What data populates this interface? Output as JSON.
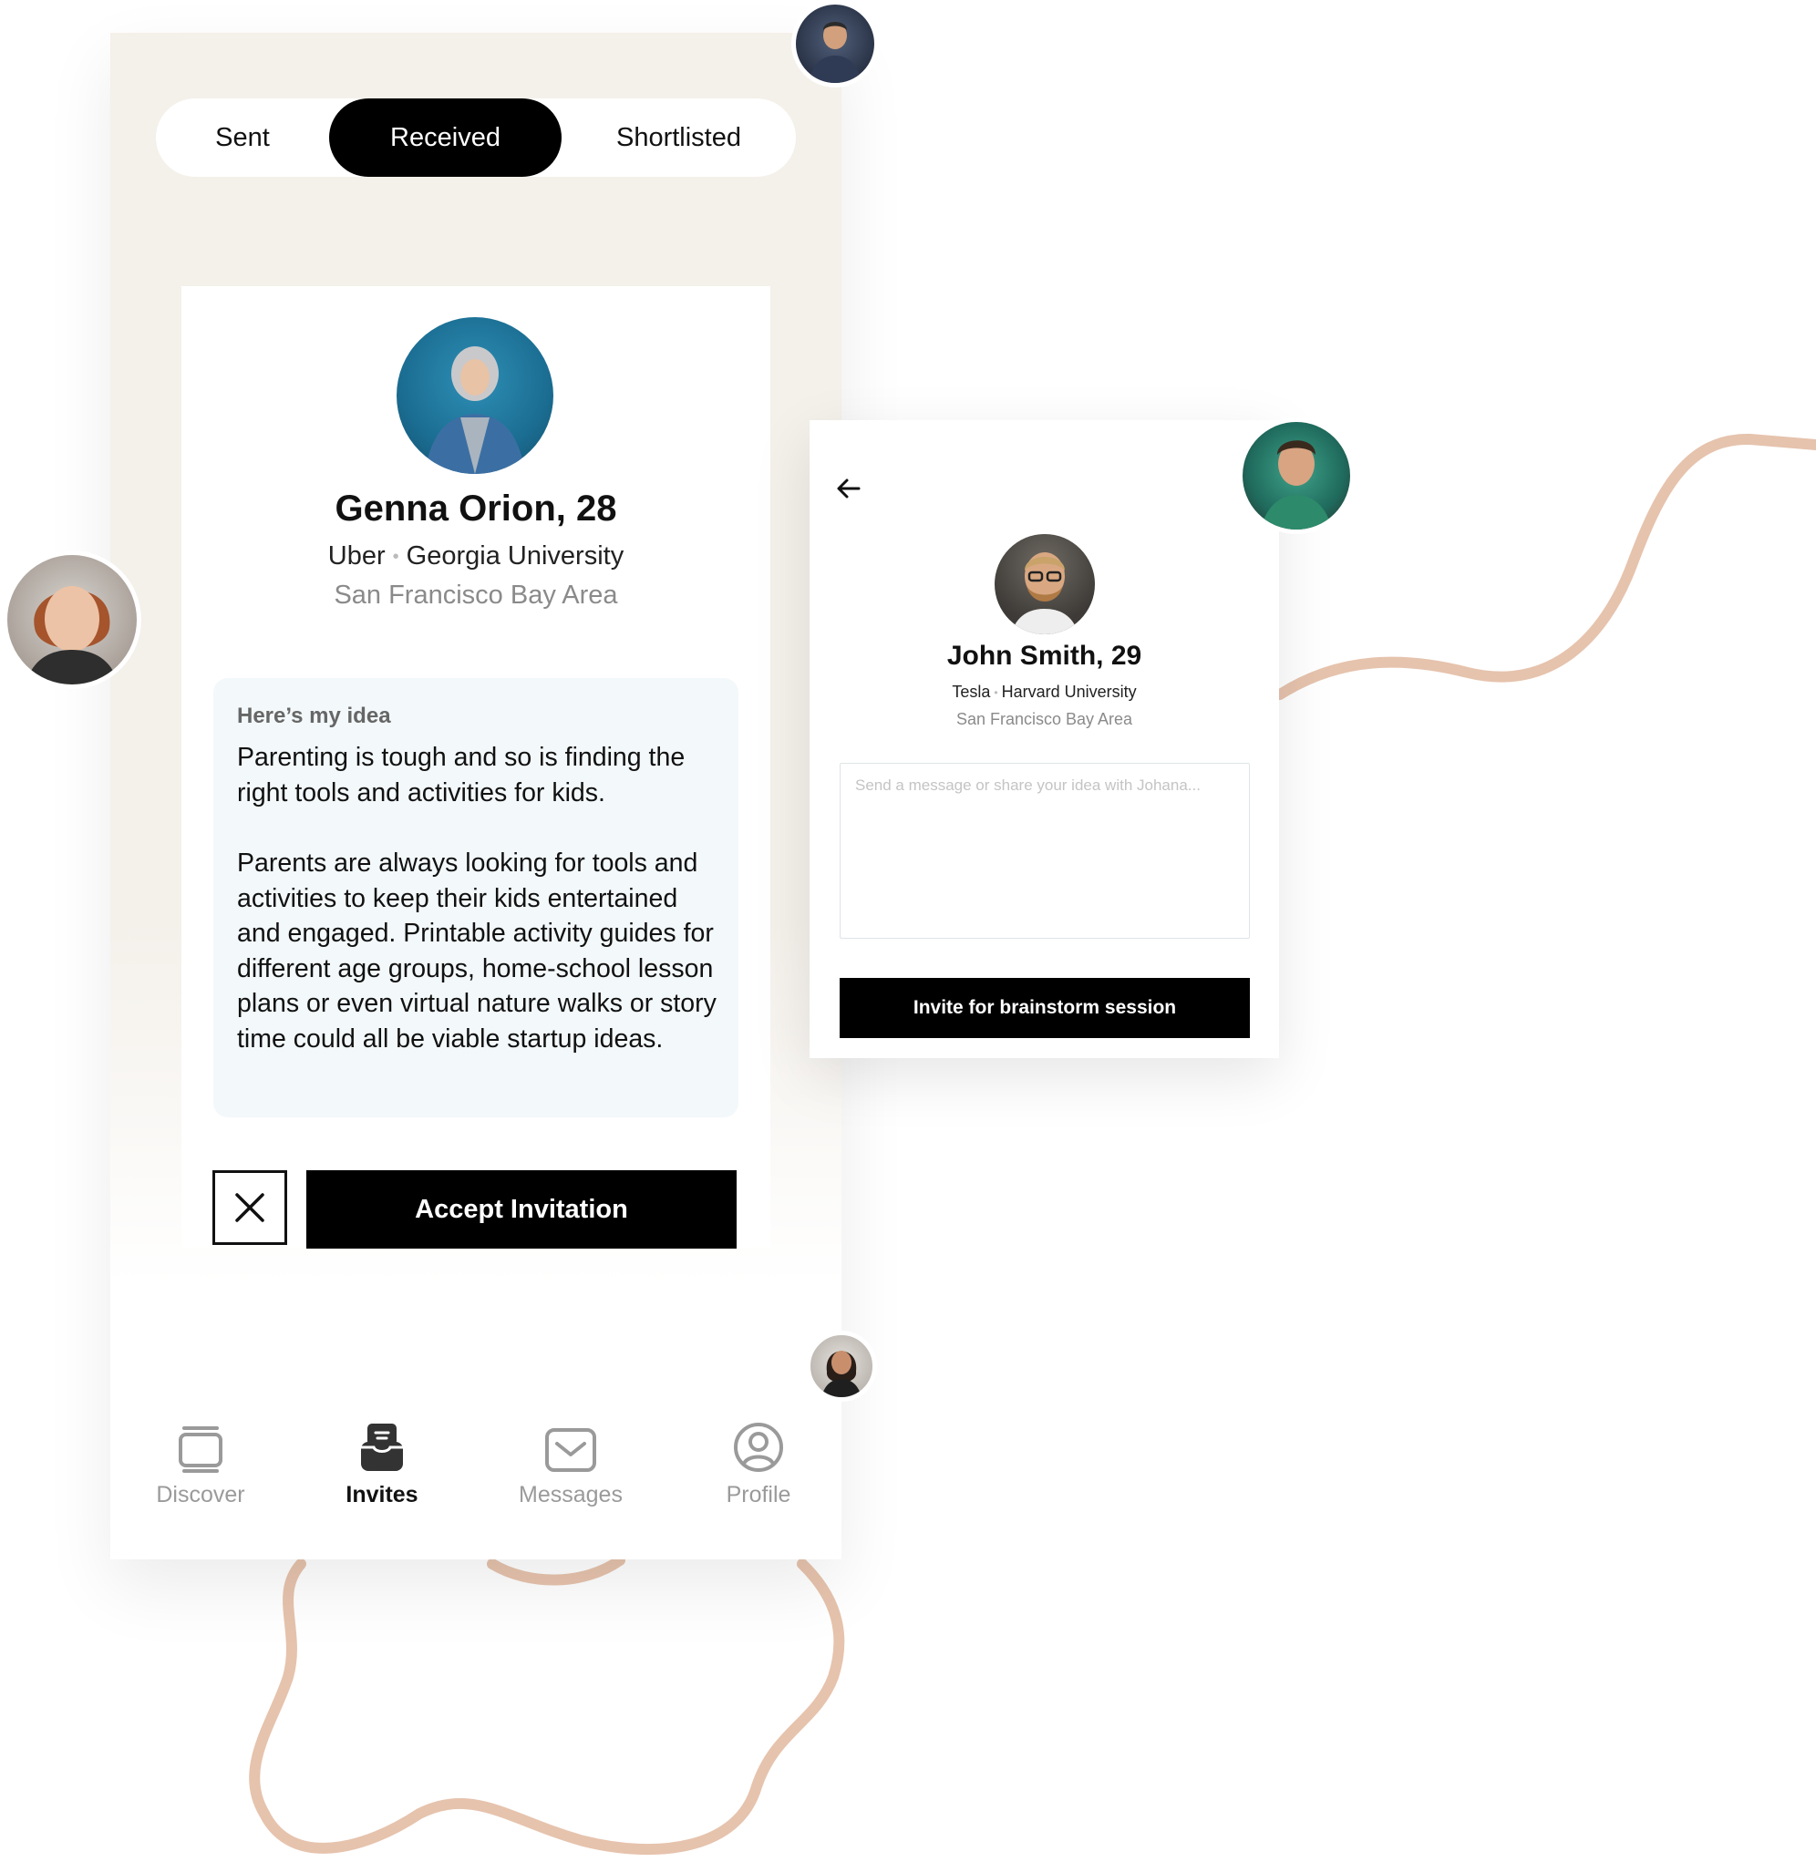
{
  "tabs": {
    "sent": "Sent",
    "received": "Received",
    "shortlisted": "Shortlisted"
  },
  "card": {
    "name": "Genna Orion, 28",
    "company": "Uber",
    "school": "Georgia University",
    "separator": "•",
    "location": "San Francisco Bay Area",
    "idea_label": "Here’s my idea",
    "idea_p1": "Parenting is tough and so is finding the right tools and activities for kids.",
    "idea_p2": "Parents are always looking for tools and activities to keep their kids entertained and engaged. Printable activity guides for different age groups, home-school lesson plans or even virtual nature walks or story time could all be viable startup ideas.",
    "accept_label": "Accept Invitation"
  },
  "nav": {
    "discover": "Discover",
    "invites": "Invites",
    "messages": "Messages",
    "profile": "Profile"
  },
  "panel": {
    "name": "John Smith, 29",
    "company": "Tesla",
    "school": "Harvard University",
    "separator": "•",
    "location": "San Francisco Bay Area",
    "message_placeholder": "Send a message or share your idea with Johana...",
    "invite_label": "Invite for brainstorm session"
  },
  "colors": {
    "phone_bg": "#f4f0ea",
    "idea_bg": "#f3f8fa",
    "accent_dark": "#000000",
    "squiggle": "#e6c3ad"
  }
}
